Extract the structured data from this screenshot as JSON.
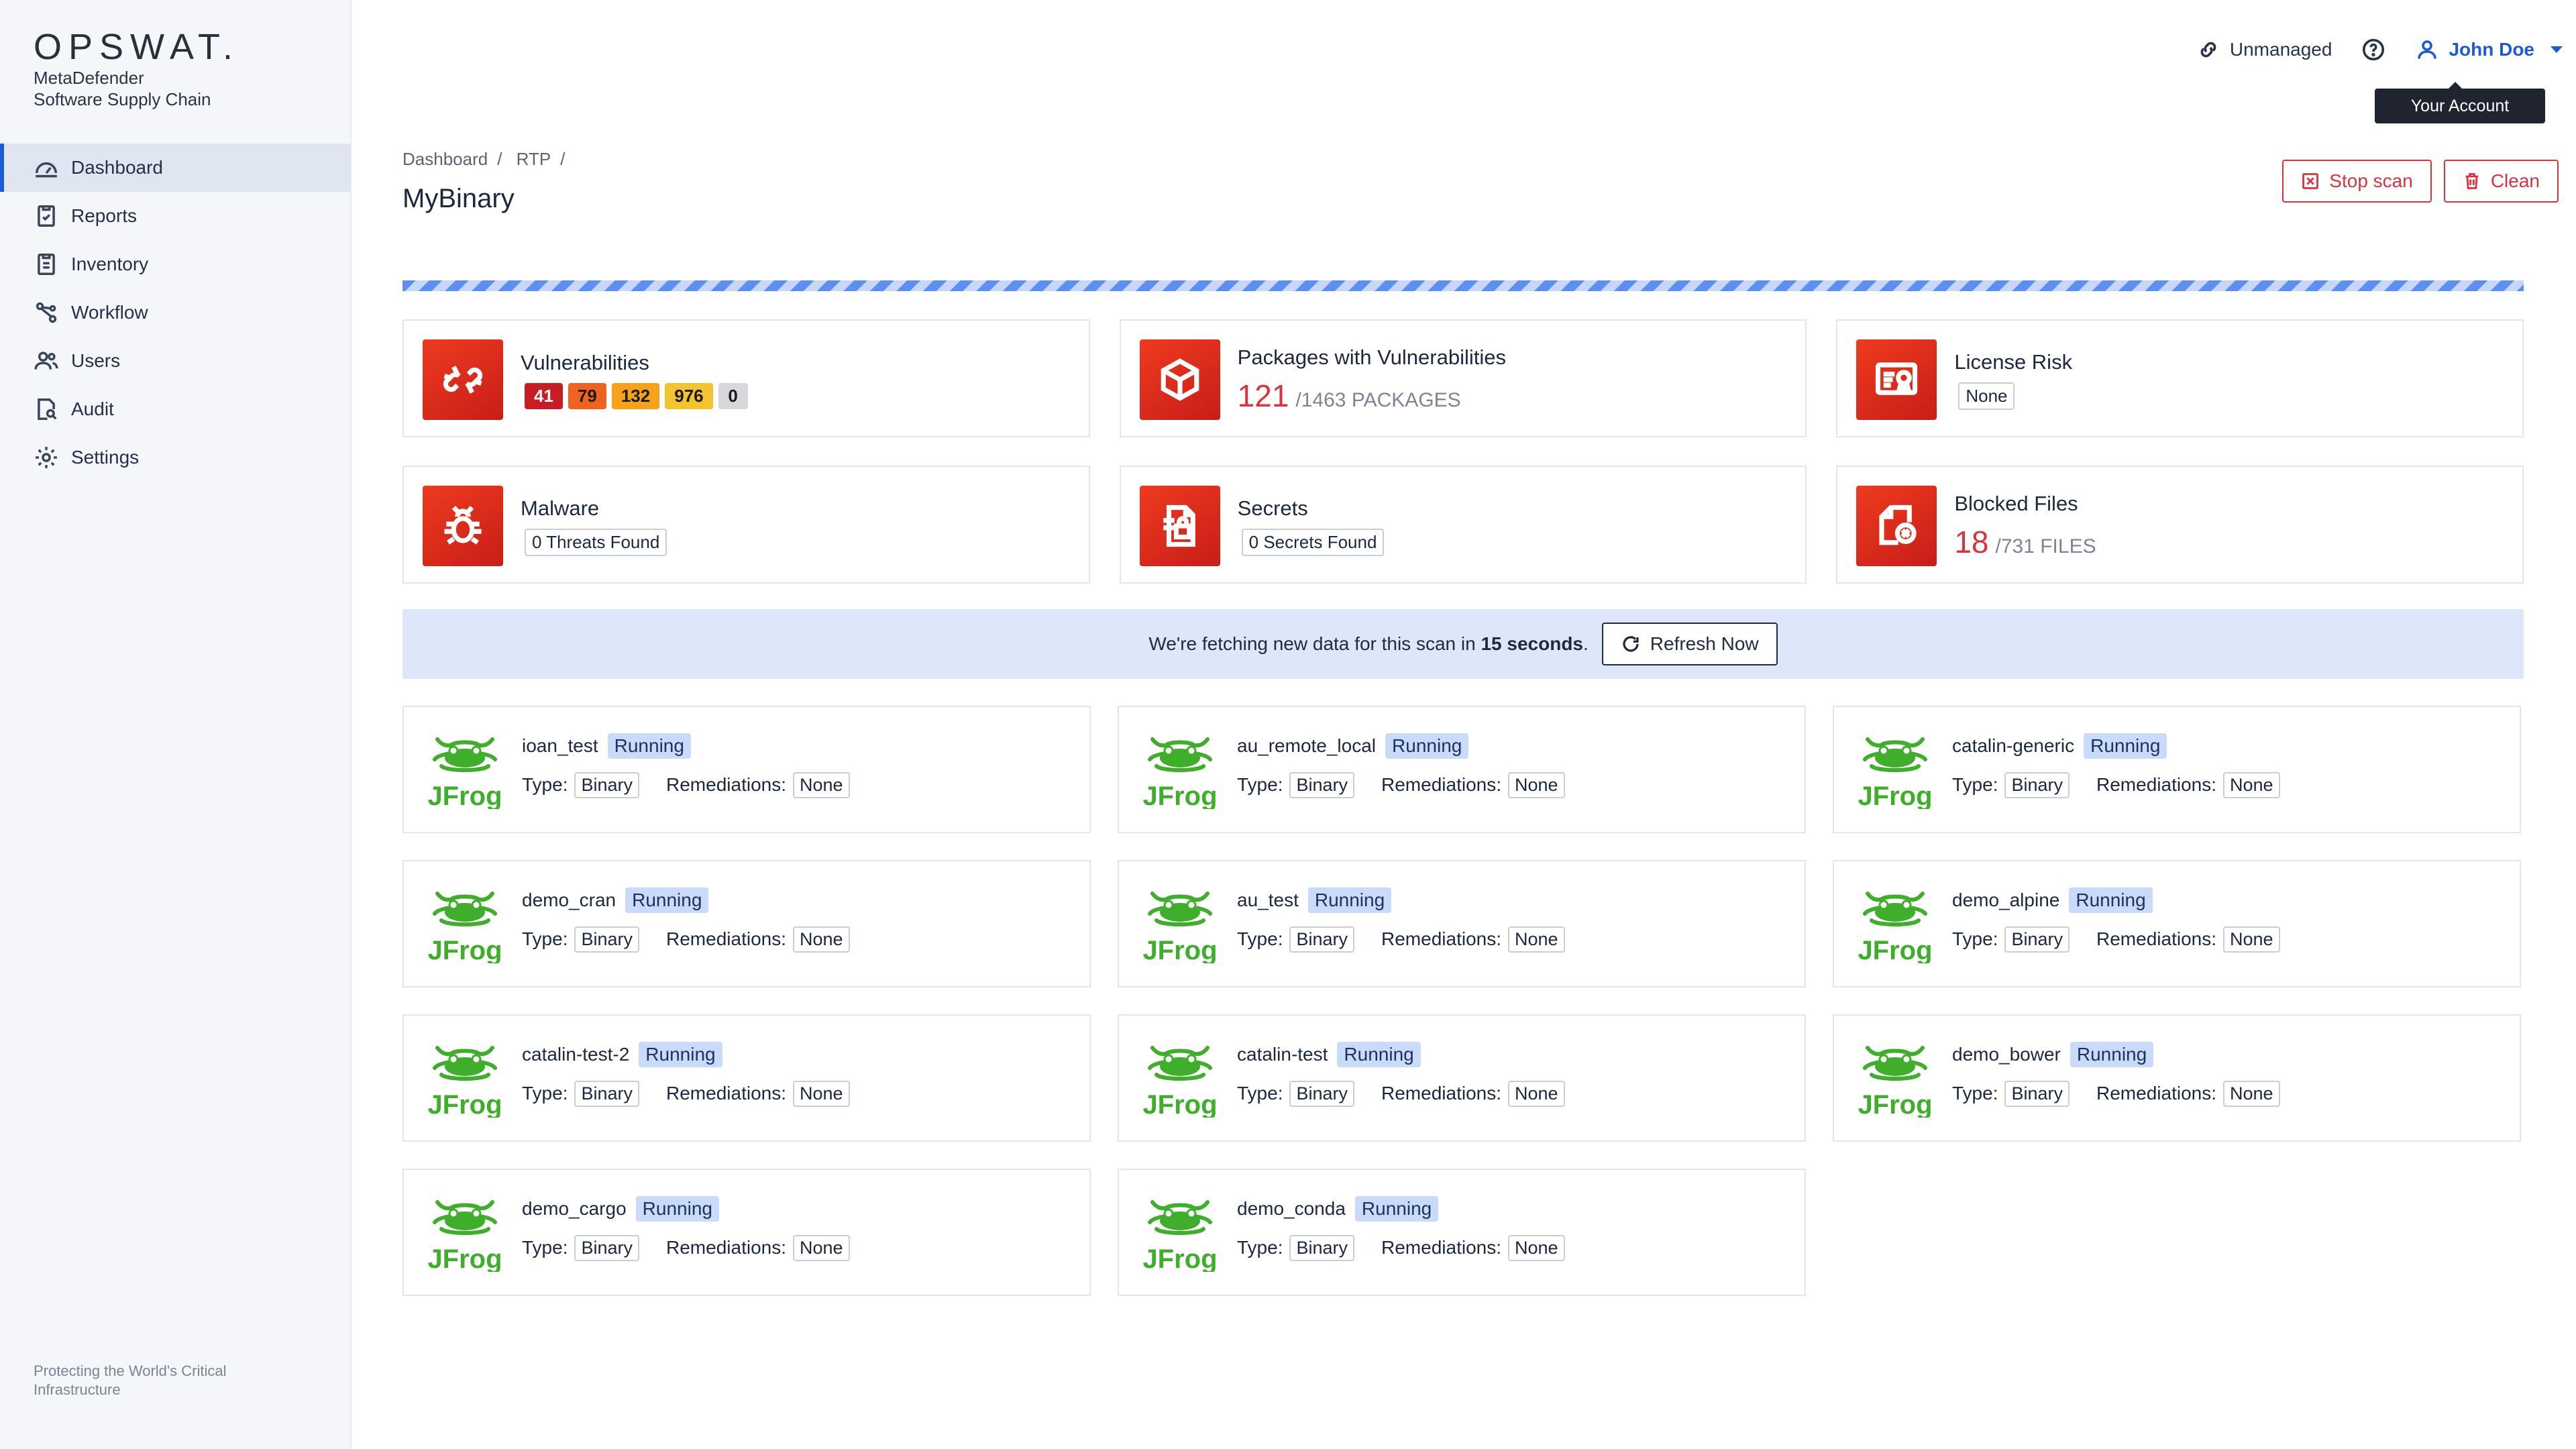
{
  "brand": {
    "logo": "OPSWAT.",
    "product_line1": "MetaDefender",
    "product_line2": "Software Supply Chain"
  },
  "sidebar": {
    "items": [
      {
        "label": "Dashboard",
        "icon": "dashboard-icon",
        "active": true
      },
      {
        "label": "Reports",
        "icon": "reports-icon"
      },
      {
        "label": "Inventory",
        "icon": "inventory-icon"
      },
      {
        "label": "Workflow",
        "icon": "workflow-icon"
      },
      {
        "label": "Users",
        "icon": "users-icon"
      },
      {
        "label": "Audit",
        "icon": "audit-icon"
      },
      {
        "label": "Settings",
        "icon": "gear-icon"
      }
    ],
    "footer": "Protecting the World's Critical Infrastructure"
  },
  "topbar": {
    "unmanaged": "Unmanaged",
    "user_name": "John Doe",
    "tooltip": "Your Account"
  },
  "breadcrumb": [
    "Dashboard",
    "RTP"
  ],
  "page_title": "MyBinary",
  "actions": {
    "stop_scan": "Stop scan",
    "clean": "Clean"
  },
  "colors": {
    "accent": "#1d5bd6",
    "danger": "#d9333d",
    "critical": "#c81d25",
    "high": "#f0621f",
    "medium": "#f7a21b",
    "low": "#f4c430",
    "unknown": "#d6d8dc"
  },
  "stats": {
    "vulnerabilities": {
      "title": "Vulnerabilities",
      "critical": "41",
      "high": "79",
      "medium": "132",
      "low": "976",
      "unknown": "0"
    },
    "packages": {
      "title": "Packages with Vulnerabilities",
      "count": "121",
      "total": "/1463 PACKAGES"
    },
    "license": {
      "title": "License Risk",
      "value": "None"
    },
    "malware": {
      "title": "Malware",
      "value": "0 Threats Found"
    },
    "secrets": {
      "title": "Secrets",
      "value": "0 Secrets Found"
    },
    "blocked": {
      "title": "Blocked Files",
      "count": "18",
      "total": "/731 FILES"
    }
  },
  "banner": {
    "text_before": "We're fetching new data for this scan in",
    "countdown": "15 seconds",
    "text_after": ".",
    "refresh_label": "Refresh Now"
  },
  "repo_labels": {
    "type": "Type:",
    "remediations": "Remediations:"
  },
  "repos": [
    {
      "name": "ioan_test",
      "status": "Running",
      "type": "Binary",
      "remediations": "None"
    },
    {
      "name": "au_remote_local",
      "status": "Running",
      "type": "Binary",
      "remediations": "None"
    },
    {
      "name": "catalin-generic",
      "status": "Running",
      "type": "Binary",
      "remediations": "None"
    },
    {
      "name": "demo_cran",
      "status": "Running",
      "type": "Binary",
      "remediations": "None"
    },
    {
      "name": "au_test",
      "status": "Running",
      "type": "Binary",
      "remediations": "None"
    },
    {
      "name": "demo_alpine",
      "status": "Running",
      "type": "Binary",
      "remediations": "None"
    },
    {
      "name": "catalin-test-2",
      "status": "Running",
      "type": "Binary",
      "remediations": "None"
    },
    {
      "name": "catalin-test",
      "status": "Running",
      "type": "Binary",
      "remediations": "None"
    },
    {
      "name": "demo_bower",
      "status": "Running",
      "type": "Binary",
      "remediations": "None"
    },
    {
      "name": "demo_cargo",
      "status": "Running",
      "type": "Binary",
      "remediations": "None"
    },
    {
      "name": "demo_conda",
      "status": "Running",
      "type": "Binary",
      "remediations": "None"
    }
  ]
}
